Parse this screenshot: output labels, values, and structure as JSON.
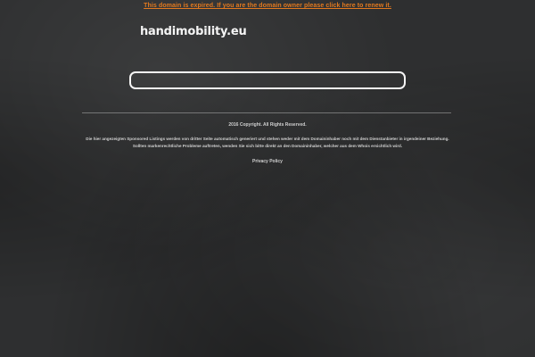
{
  "banner": {
    "expired_text": "This domain is expired. If you are the domain owner please click here to renew it."
  },
  "header": {
    "site_title": "handimobility.eu"
  },
  "search": {
    "value": "",
    "placeholder": ""
  },
  "footer": {
    "copyright": "2016 Copyright. All Rights Reserved.",
    "disclaimer_line1": "Die hier angezeigten Sponsored Listings werden von dritter Seite automatisch generiert und stehen weder mit dem Domaininhaber noch mit dem Dienstanbieter in irgendeiner Beziehung.",
    "disclaimer_line2": "Sollten markenrechtliche Probleme auftreten, wenden Sie sich bitte direkt an den Domaininhaber, welcher aus dem Whois ersichtlich wird.",
    "privacy_link": "Privacy Policy"
  },
  "colors": {
    "background": "#2e2f30",
    "banner_link": "#e2791f",
    "text": "#f4f4f4"
  }
}
